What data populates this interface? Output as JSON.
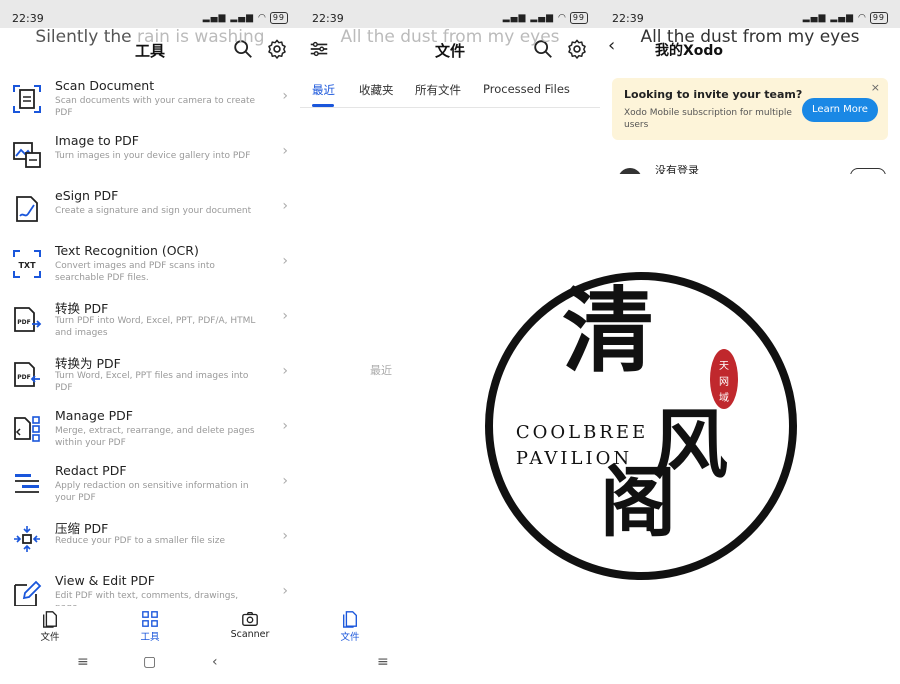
{
  "status": {
    "time": "22:39",
    "battery": "99",
    "signal_text": "⁵ᴳıll ıll"
  },
  "panel1": {
    "watermark_pre": "Silently the",
    "watermark_faint": "rain is washing",
    "title": "工具",
    "tools": [
      {
        "icon": "scan-document-icon",
        "title": "Scan Document",
        "desc": "Scan documents with your camera to create PDF"
      },
      {
        "icon": "image-to-pdf-icon",
        "title": "Image to PDF",
        "desc": "Turn images in your device gallery into PDF"
      },
      {
        "icon": "esign-icon",
        "title": "eSign PDF",
        "desc": "Create a signature and sign your document"
      },
      {
        "icon": "ocr-icon",
        "title": "Text Recognition (OCR)",
        "desc": "Convert images and PDF scans into searchable PDF files."
      },
      {
        "icon": "convert-pdf-icon",
        "title": "转换 PDF",
        "desc": "Turn PDF into Word, Excel, PPT, PDF/A, HTML and images"
      },
      {
        "icon": "convert-to-pdf-icon",
        "title": "转换为 PDF",
        "desc": "Turn Word, Excel, PPT files and images into PDF"
      },
      {
        "icon": "manage-pdf-icon",
        "title": "Manage PDF",
        "desc": "Merge, extract, rearrange, and delete pages within your PDF"
      },
      {
        "icon": "redact-icon",
        "title": "Redact PDF",
        "desc": "Apply redaction on sensitive information in your PDF"
      },
      {
        "icon": "compress-icon",
        "title": "压缩 PDF",
        "desc": "Reduce your PDF to a smaller file size"
      },
      {
        "icon": "edit-pdf-icon",
        "title": "View & Edit PDF",
        "desc": "Edit PDF with text, comments, drawings, page"
      }
    ],
    "nav": [
      {
        "icon": "files-icon",
        "label": "文件"
      },
      {
        "icon": "tools-icon",
        "label": "工具"
      },
      {
        "icon": "camera-icon",
        "label": "Scanner"
      }
    ]
  },
  "panel2": {
    "watermark": "All the dust from my eyes",
    "title": "文件",
    "tabs": [
      "最近",
      "收藏夹",
      "所有文件",
      "Processed Files"
    ],
    "empty_label": "最近",
    "nav_label": "文件"
  },
  "panel3": {
    "watermark": "All the dust from my eyes",
    "title": "我的Xodo",
    "banner": {
      "title": "Looking to invite your team?",
      "text": "Xodo Mobile subscription for multiple users",
      "button": "Learn More",
      "close": "×"
    },
    "account_label": "没有登录"
  },
  "logo": {
    "char1": "清",
    "char2": "风",
    "char3": "阁",
    "line1": "COOLBREE",
    "line2": "PAVILION",
    "seal": [
      "天",
      "网",
      "域"
    ]
  },
  "colors": {
    "accent": "#1a56db",
    "banner_bg": "#fdf4d9",
    "learn_btn": "#1a88e5",
    "seal": "#c0282d"
  }
}
